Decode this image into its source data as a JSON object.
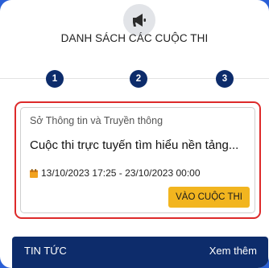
{
  "header": {
    "icon": "megaphone-icon",
    "title": "DANH SÁCH CÁC CUỘC THI"
  },
  "steps": [
    "1",
    "2",
    "3"
  ],
  "contest": {
    "organization": "Sở Thông tin và Truyền thông",
    "title": "Cuộc thi trực tuyến tìm hiểu nền tảng...",
    "date_range": "13/10/2023 17:25 - 23/10/2023 00:00",
    "join_label": "VÀO CUỘC THI"
  },
  "news": {
    "title": "TIN TỨC",
    "more_label": "Xem thêm"
  },
  "colors": {
    "accent_navy": "#0d2c6b",
    "button_yellow": "#f2b51f",
    "highlight_red": "#dd2a2a",
    "background_blue": "#2a5fd6"
  }
}
